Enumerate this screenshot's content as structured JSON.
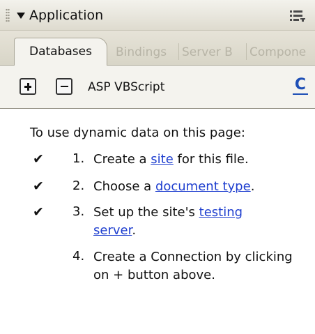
{
  "panel": {
    "title": "Application",
    "collapse_icon": "triangle-down-icon",
    "options_icon": "panel-options-icon"
  },
  "tabs": [
    {
      "label": "Databases",
      "active": true
    },
    {
      "label": "Bindings",
      "active": false
    },
    {
      "label": "Server B",
      "active": false
    },
    {
      "label": "Compone",
      "active": false
    }
  ],
  "toolbar": {
    "add_icon": "plus-icon",
    "remove_icon": "minus-icon",
    "server_model": "ASP VBScript",
    "refresh_icon": "refresh-icon"
  },
  "instructions": {
    "intro": "To use dynamic data on this page:",
    "steps": [
      {
        "number": "1.",
        "checked": true,
        "before": "Create a ",
        "link": "site",
        "after": " for this file."
      },
      {
        "number": "2.",
        "checked": true,
        "before": "Choose a ",
        "link": "document type",
        "after": "."
      },
      {
        "number": "3.",
        "checked": true,
        "before": "Set up the site's ",
        "link": "testing server",
        "after": "."
      },
      {
        "number": "4.",
        "checked": false,
        "text": "Create a Connection by clicking on + button above."
      }
    ],
    "check_glyph": "✔"
  },
  "colors": {
    "link": "#1f3fcf",
    "titlebar": "#e8e6dc",
    "refresh": "#1e4fb6"
  }
}
